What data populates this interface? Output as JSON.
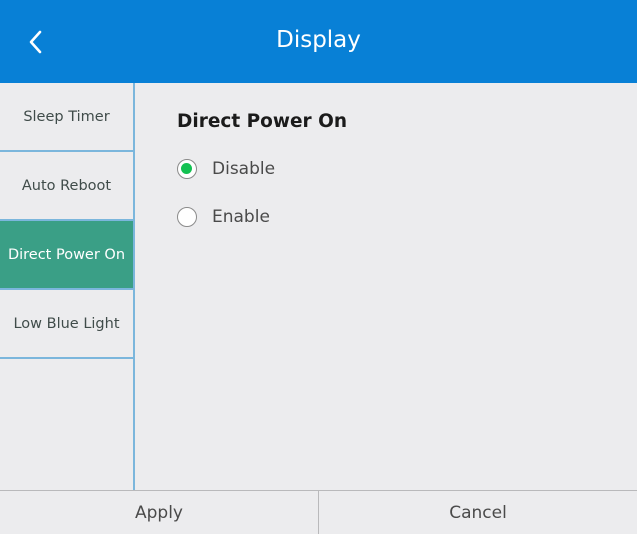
{
  "header": {
    "title": "Display",
    "back_icon": "chevron-left-icon"
  },
  "sidebar": {
    "items": [
      {
        "label": "Sleep Timer",
        "active": false
      },
      {
        "label": "Auto Reboot",
        "active": false
      },
      {
        "label": "Direct Power On",
        "active": true
      },
      {
        "label": "Low Blue Light",
        "active": false
      }
    ]
  },
  "main": {
    "section_title": "Direct Power On",
    "options": [
      {
        "label": "Disable",
        "selected": true
      },
      {
        "label": "Enable",
        "selected": false
      }
    ]
  },
  "footer": {
    "apply_label": "Apply",
    "cancel_label": "Cancel"
  },
  "colors": {
    "header_bg": "#0880d6",
    "active_item_bg": "#3a9f86",
    "radio_selected": "#13c152",
    "divider": "#7bb6dc"
  }
}
